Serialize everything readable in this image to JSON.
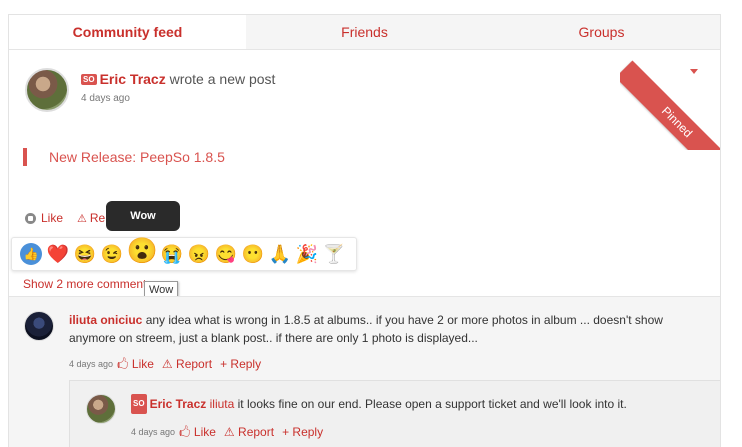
{
  "tabs": [
    "Community feed",
    "Friends",
    "Groups"
  ],
  "post": {
    "badge": "SO",
    "author": "Eric Tracz",
    "action": "wrote a new post",
    "time": "4 days ago",
    "pinned": "Pinned",
    "quote": "New Release: PeepSo 1.8.5"
  },
  "actions": {
    "like": "Like",
    "report": "Report"
  },
  "reaction_tooltip": "Wow",
  "reactions": [
    "👍",
    "❤️",
    "😆",
    "😉",
    "😮",
    "😭",
    "😠",
    "😋",
    "😶",
    "🙏",
    "🎉",
    "🍸"
  ],
  "show_more": "Show 2 more comments",
  "hover_tooltip": "Wow",
  "comment": {
    "author": "iliuta oniciuc",
    "text": "any idea what is wrong in 1.8.5 at albums.. if you have 2 or more photos in album ... doesn't show anymore on streem, just a blank post.. if there are only 1 photo is displayed...",
    "time": "4 days ago",
    "like": "Like",
    "report": "Report",
    "reply": "Reply"
  },
  "reply": {
    "badge": "SO",
    "author": "Eric Tracz",
    "mention": "iliuta",
    "text": "it looks fine on our end. Please open a support ticket and we'll look into it.",
    "time": "4 days ago",
    "like": "Like",
    "report": "Report",
    "reply": "Reply"
  },
  "colors": {
    "accent": "#d9534f",
    "link": "#c9302c"
  }
}
